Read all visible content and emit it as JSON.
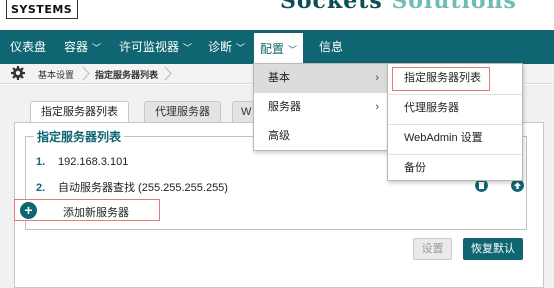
{
  "header": {
    "logo_text": "SYSTEMS",
    "banner_text_1": "Sockets ",
    "banner_text_2": "Solutions"
  },
  "nav": {
    "items": [
      {
        "label": "仪表盘"
      },
      {
        "label": "容器",
        "chev": "﹀"
      },
      {
        "label": "许可监视器",
        "chev": "﹀"
      },
      {
        "label": "诊断",
        "chev": "﹀"
      },
      {
        "label": "配置",
        "chev": "﹀"
      },
      {
        "label": "信息"
      }
    ]
  },
  "breadcrumb": {
    "items": [
      "基本设置",
      "指定服务器列表"
    ],
    "icon": "gear-icon"
  },
  "tabs": [
    {
      "label": "指定服务器列表"
    },
    {
      "label": "代理服务器"
    },
    {
      "label": "W"
    }
  ],
  "server_list": {
    "title": "指定服务器列表",
    "rows": [
      {
        "num": "1.",
        "value": "192.168.3.101"
      },
      {
        "num": "2.",
        "value": "自动服务器查找 (255.255.255.255)"
      }
    ],
    "add_label": "添加新服务器",
    "add_symbol": "+"
  },
  "buttons": {
    "settings": "设置",
    "restore": "恢复默认"
  },
  "config_menu": {
    "items": [
      {
        "label": "基本",
        "arrow": "›"
      },
      {
        "label": "服务器",
        "arrow": "›"
      },
      {
        "label": "高级"
      }
    ]
  },
  "basic_submenu": {
    "items": [
      {
        "label": "指定服务器列表"
      },
      {
        "label": "代理服务器"
      },
      {
        "label": "WebAdmin 设置"
      },
      {
        "label": "备份"
      }
    ]
  },
  "colors": {
    "brand": "#0f6672",
    "highlight_border": "#e37a7a"
  }
}
